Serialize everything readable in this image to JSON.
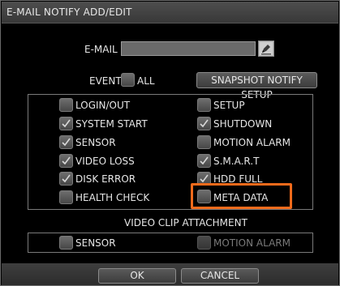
{
  "dialog": {
    "title": "E-MAIL NOTIFY ADD/EDIT",
    "email_label": "E-MAIL",
    "email_value": "",
    "keyboard_icon": "keyboard-edit-icon",
    "event_label": "EVENT",
    "all_label": "ALL",
    "all_checked": false,
    "snapshot_button": "SNAPSHOT NOTIFY SETUP",
    "events": [
      {
        "label": "LOGIN/OUT",
        "checked": false
      },
      {
        "label": "SETUP",
        "checked": false
      },
      {
        "label": "SYSTEM START",
        "checked": true
      },
      {
        "label": "SHUTDOWN",
        "checked": true
      },
      {
        "label": "SENSOR",
        "checked": true
      },
      {
        "label": "MOTION ALARM",
        "checked": false
      },
      {
        "label": "VIDEO LOSS",
        "checked": true
      },
      {
        "label": "S.M.A.R.T",
        "checked": true
      },
      {
        "label": "DISK ERROR",
        "checked": true
      },
      {
        "label": "HDD FULL",
        "checked": true
      },
      {
        "label": "HEALTH CHECK",
        "checked": false
      },
      {
        "label": "META DATA",
        "checked": false
      }
    ],
    "video_clip_title": "VIDEO CLIP ATTACHMENT",
    "clip_sensor_label": "SENSOR",
    "clip_motion_label": "MOTION ALARM",
    "ok_button": "OK",
    "cancel_button": "CANCEL",
    "highlight_color": "#f26a1b"
  }
}
